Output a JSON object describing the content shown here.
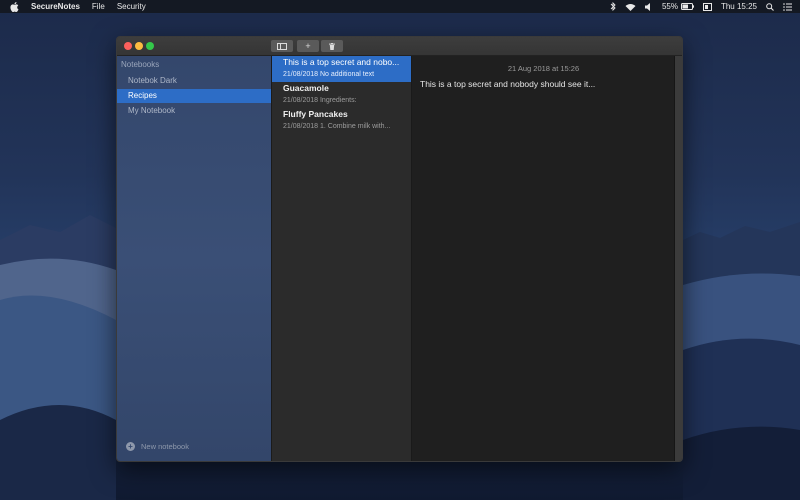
{
  "menubar": {
    "app_name": "SecureNotes",
    "menus": [
      "File",
      "Security"
    ],
    "battery": "55%",
    "clock": "Thu 15:25"
  },
  "toolbar": {
    "sidebar_toggle_icon": "sidebar-icon",
    "add_label": "+",
    "delete_icon": "trash-icon"
  },
  "sidebar": {
    "header": "Notebooks",
    "items": [
      {
        "label": "Notebok Dark",
        "selected": false
      },
      {
        "label": "Recipes",
        "selected": true
      },
      {
        "label": "My Notebook",
        "selected": false
      }
    ],
    "new_notebook_label": "New notebook"
  },
  "notes": [
    {
      "title": "This is a top secret and nobo...",
      "subtitle": "21/08/2018 No additional text",
      "selected": true
    },
    {
      "title": "Guacamole",
      "subtitle": "21/08/2018 Ingredients:",
      "selected": false
    },
    {
      "title": "Fluffy Pancakes",
      "subtitle": "21/08/2018 1. Combine milk with...",
      "selected": false
    }
  ],
  "editor": {
    "date": "21 Aug 2018 at 15:26",
    "body": "This is a top secret and nobody should see it..."
  },
  "colors": {
    "accent": "#2d6dc6",
    "sidebar": "#3a4f76",
    "editor": "#1f1f1f"
  }
}
